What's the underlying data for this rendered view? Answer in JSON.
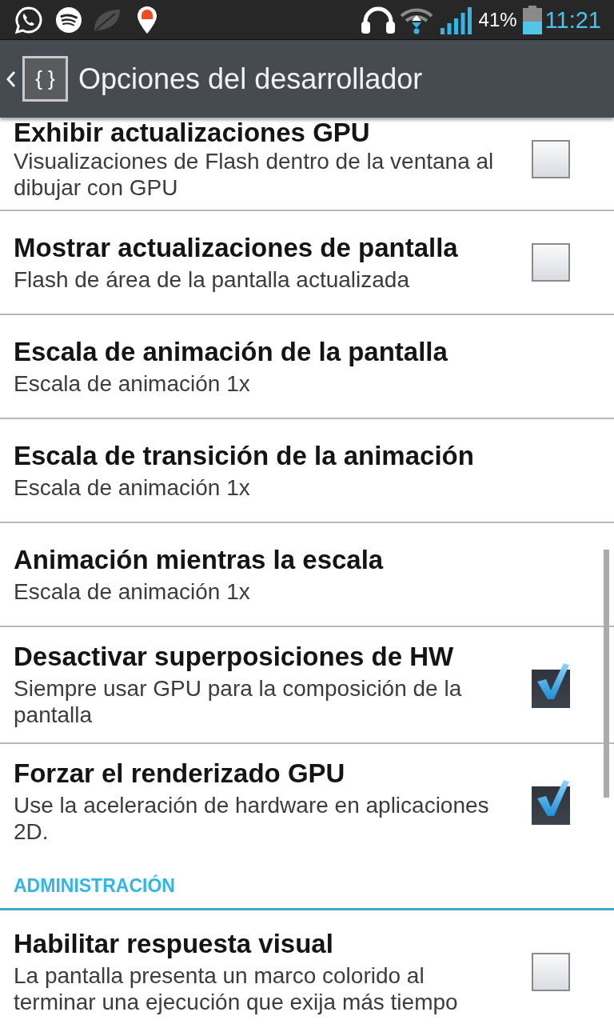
{
  "status_bar": {
    "battery_percent": "41%",
    "time": "11:21"
  },
  "action_bar": {
    "icon_glyph": "{ }",
    "title": "Opciones del desarrollador"
  },
  "settings": [
    {
      "kind": "checkbox",
      "title": "Exhibir actualizaciones GPU",
      "summary": "Visualizaciones de Flash dentro de la ventana al dibujar con GPU",
      "checked": false
    },
    {
      "kind": "checkbox",
      "title": "Mostrar actualizaciones de pantalla",
      "summary": "Flash de área de la pantalla actualizada",
      "checked": false
    },
    {
      "kind": "value",
      "title": "Escala de animación de la pantalla",
      "summary": "Escala de animación 1x"
    },
    {
      "kind": "value",
      "title": "Escala de transición de la animación",
      "summary": "Escala de animación 1x"
    },
    {
      "kind": "value",
      "title": "Animación mientras la escala",
      "summary": "Escala de animación 1x"
    },
    {
      "kind": "checkbox",
      "title": "Desactivar superposiciones de HW",
      "summary": "Siempre usar GPU para la composición de la pantalla",
      "checked": true
    },
    {
      "kind": "checkbox",
      "title": "Forzar el renderizado GPU",
      "summary": "Use la aceleración de hardware en aplicaciones 2D.",
      "checked": true
    }
  ],
  "sections": [
    {
      "title": "ADMINISTRACIÓN",
      "settings": [
        {
          "kind": "checkbox",
          "title": "Habilitar respuesta visual",
          "summary": "La pantalla presenta un marco colorido al terminar una ejecución que exija más tiempo",
          "checked": false
        }
      ]
    }
  ]
}
